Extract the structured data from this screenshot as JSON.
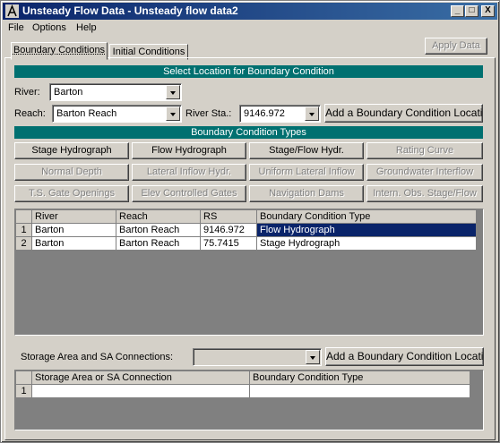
{
  "window": {
    "title": "Unsteady Flow Data - Unsteady flow data2",
    "controls": {
      "minimize": "_",
      "maximize": "□",
      "close": "X"
    }
  },
  "menu": [
    "File",
    "Options",
    "Help"
  ],
  "tabs": {
    "boundary": "Boundary Conditions",
    "initial": "Initial Conditions"
  },
  "apply_label": "Apply Data",
  "location": {
    "header": "Select Location for Boundary Condition",
    "river_label": "River:",
    "river_value": "Barton",
    "reach_label": "Reach:",
    "reach_value": "Barton Reach",
    "station_label": "River Sta.:",
    "station_value": "9146.972",
    "add_button": "Add a Boundary Condition Location"
  },
  "types": {
    "header": "Boundary Condition Types",
    "buttons": [
      {
        "label": "Stage Hydrograph",
        "enabled": true
      },
      {
        "label": "Flow Hydrograph",
        "enabled": true
      },
      {
        "label": "Stage/Flow Hydr.",
        "enabled": true
      },
      {
        "label": "Rating Curve",
        "enabled": false
      },
      {
        "label": "Normal Depth",
        "enabled": false
      },
      {
        "label": "Lateral Inflow Hydr.",
        "enabled": false
      },
      {
        "label": "Uniform Lateral Inflow",
        "enabled": false
      },
      {
        "label": "Groundwater Interflow",
        "enabled": false
      },
      {
        "label": "T.S. Gate Openings",
        "enabled": false
      },
      {
        "label": "Elev Controlled Gates",
        "enabled": false
      },
      {
        "label": "Navigation Dams",
        "enabled": false
      },
      {
        "label": "Intern. Obs. Stage/Flow",
        "enabled": false
      }
    ]
  },
  "bc_table": {
    "columns": [
      "River",
      "Reach",
      "RS",
      "Boundary Condition Type"
    ],
    "rows": [
      {
        "num": "1",
        "river": "Barton",
        "reach": "Barton Reach",
        "rs": "9146.972",
        "type": "Flow Hydrograph"
      },
      {
        "num": "2",
        "river": "Barton",
        "reach": "Barton Reach",
        "rs": "75.7415",
        "type": "Stage Hydrograph"
      }
    ]
  },
  "storage": {
    "label": "Storage Area and SA Connections:",
    "value": "",
    "add_button": "Add a Boundary Condition Location"
  },
  "sa_table": {
    "columns": [
      "Storage Area or SA Connection",
      "Boundary Condition Type"
    ],
    "rows": [
      {
        "num": "1",
        "area": "",
        "type": ""
      }
    ]
  }
}
